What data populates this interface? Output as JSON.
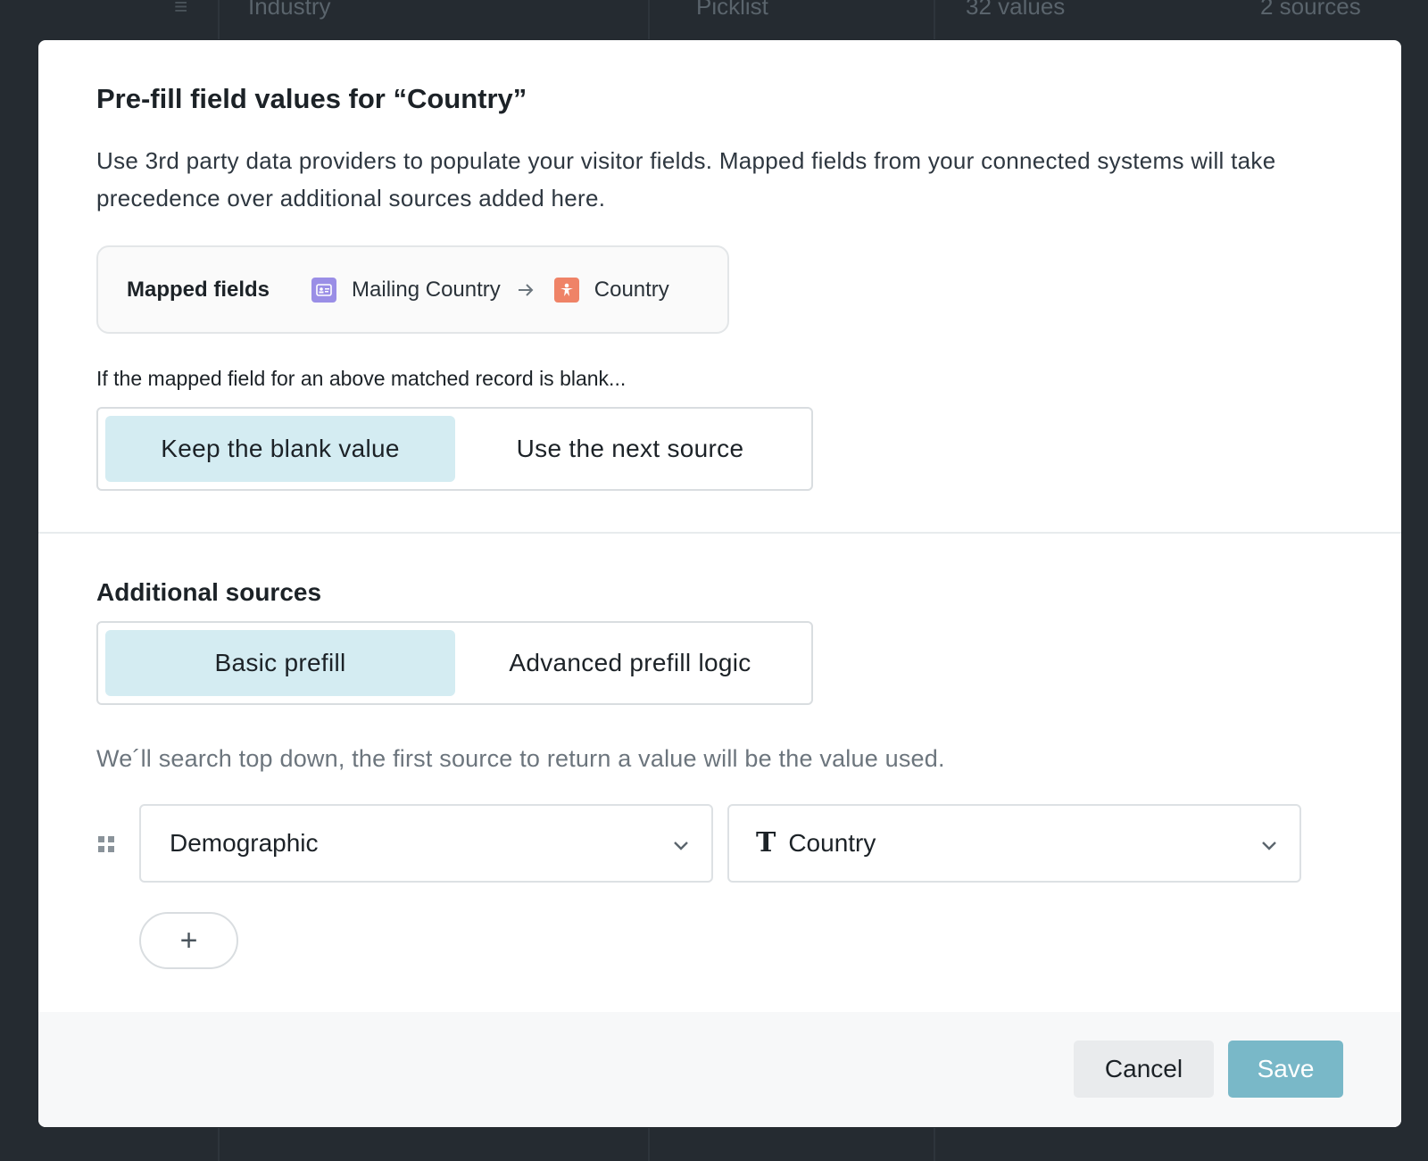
{
  "background": {
    "cells": [
      "Industry",
      "Picklist",
      "32 values",
      "2 sources"
    ]
  },
  "modal": {
    "title": "Pre-fill field values for “Country”",
    "description": "Use 3rd party data providers to populate your visitor fields. Mapped fields from your connected systems will take precedence over additional sources added here.",
    "mapped_fields": {
      "label": "Mapped fields",
      "source": "Mailing Country",
      "destination": "Country"
    },
    "blank_condition": {
      "label": "If the mapped field for an above matched record is blank...",
      "options": [
        "Keep the blank value",
        "Use the next source"
      ],
      "selected": "Keep the blank value"
    },
    "additional_sources": {
      "title": "Additional sources",
      "options": [
        "Basic prefill",
        "Advanced prefill logic"
      ],
      "selected": "Basic prefill",
      "hint": "We´ll search top down, the first source to return a value will be the value used.",
      "rows": [
        {
          "provider": "Demographic",
          "field": "Country"
        }
      ],
      "add_label": "+"
    },
    "footer": {
      "cancel": "Cancel",
      "save": "Save"
    }
  }
}
